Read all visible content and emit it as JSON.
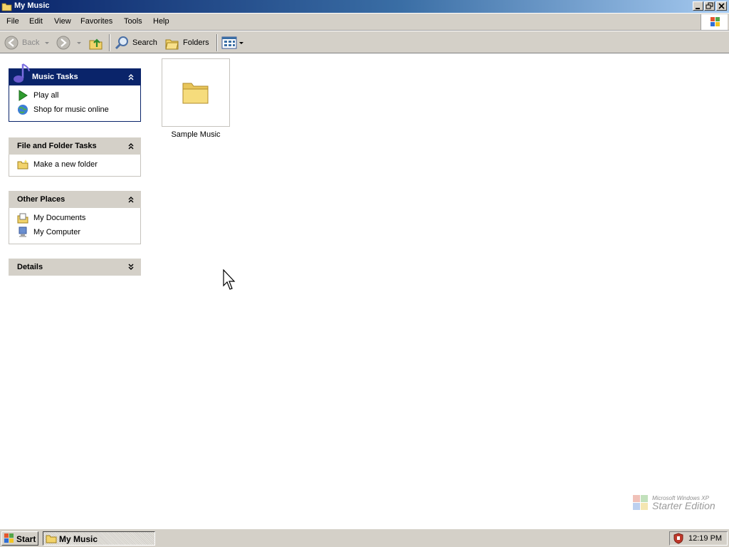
{
  "window": {
    "title": "My Music"
  },
  "menu": [
    "File",
    "Edit",
    "View",
    "Favorites",
    "Tools",
    "Help"
  ],
  "toolbar": {
    "back": "Back",
    "search": "Search",
    "folders": "Folders"
  },
  "taskpane": {
    "music_tasks": {
      "title": "Music Tasks",
      "items": [
        "Play all",
        "Shop for music online"
      ]
    },
    "file_folder_tasks": {
      "title": "File and Folder Tasks",
      "items": [
        "Make a new folder"
      ]
    },
    "other_places": {
      "title": "Other Places",
      "items": [
        "My Documents",
        "My Computer"
      ]
    },
    "details": {
      "title": "Details"
    }
  },
  "content": {
    "items": [
      {
        "label": "Sample Music",
        "icon": "folder-icon"
      }
    ]
  },
  "watermark": {
    "line1": "Microsoft Windows XP",
    "line2": "Starter Edition"
  },
  "taskbar": {
    "start": "Start",
    "window_button": "My Music",
    "clock": "12:19 PM"
  },
  "colors": {
    "title_gradient_start": "#0a246a",
    "title_gradient_end": "#a6caf0",
    "chrome": "#d4d0c8",
    "music_header": "#0a246a"
  }
}
